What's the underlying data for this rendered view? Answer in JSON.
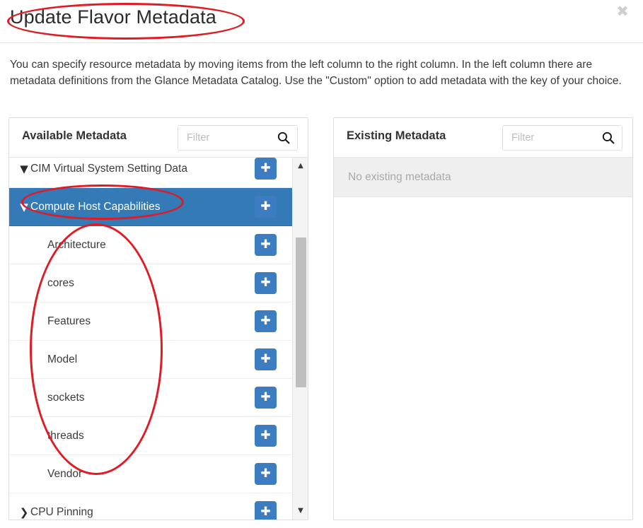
{
  "modal": {
    "title": "Update Flavor Metadata",
    "close_label": "✖",
    "close_icon": "close-icon",
    "description": "You can specify resource metadata by moving items from the left column to the right column. In the left column there are metadata definitions from the Glance Metadata Catalog. Use the \"Custom\" option to add metadata with the key of your choice."
  },
  "available_panel": {
    "title": "Available Metadata",
    "filter_placeholder": "Filter",
    "filter_value": "",
    "search_icon": "search-icon",
    "add_button_label": "✚",
    "rows": [
      {
        "label": "CIM Virtual System Setting Data",
        "type": "group",
        "expanded": true,
        "chevron": "▼",
        "selected": false
      },
      {
        "label": "Compute Host Capabilities",
        "type": "group",
        "expanded": true,
        "chevron": "▼",
        "selected": true
      },
      {
        "label": "Architecture",
        "type": "child",
        "expanded": null,
        "chevron": "",
        "selected": false
      },
      {
        "label": "cores",
        "type": "child",
        "expanded": null,
        "chevron": "",
        "selected": false
      },
      {
        "label": "Features",
        "type": "child",
        "expanded": null,
        "chevron": "",
        "selected": false
      },
      {
        "label": "Model",
        "type": "child",
        "expanded": null,
        "chevron": "",
        "selected": false
      },
      {
        "label": "sockets",
        "type": "child",
        "expanded": null,
        "chevron": "",
        "selected": false
      },
      {
        "label": "threads",
        "type": "child",
        "expanded": null,
        "chevron": "",
        "selected": false
      },
      {
        "label": "Vendor",
        "type": "child",
        "expanded": null,
        "chevron": "",
        "selected": false
      },
      {
        "label": "CPU Pinning",
        "type": "group",
        "expanded": false,
        "chevron": "❯",
        "selected": false
      }
    ],
    "scrollbar": {
      "up_arrow": "▲",
      "down_arrow": "▼"
    }
  },
  "existing_panel": {
    "title": "Existing Metadata",
    "filter_placeholder": "Filter",
    "filter_value": "",
    "search_icon": "search-icon",
    "empty_message": "No existing metadata"
  },
  "colors": {
    "accent_blue": "#337ab7",
    "add_button_blue": "#3b7dc0",
    "annotation_red": "#e01b24",
    "empty_row_bg": "#efefef",
    "scrollbar_thumb": "#bfbfbf"
  },
  "annotations": [
    {
      "name": "title-ellipse",
      "shape": "ellipse",
      "color": "#e01b24"
    },
    {
      "name": "selected-row-ellipse",
      "shape": "ellipse",
      "color": "#e01b24"
    },
    {
      "name": "child-items-ellipse",
      "shape": "ellipse",
      "color": "#e01b24"
    }
  ]
}
